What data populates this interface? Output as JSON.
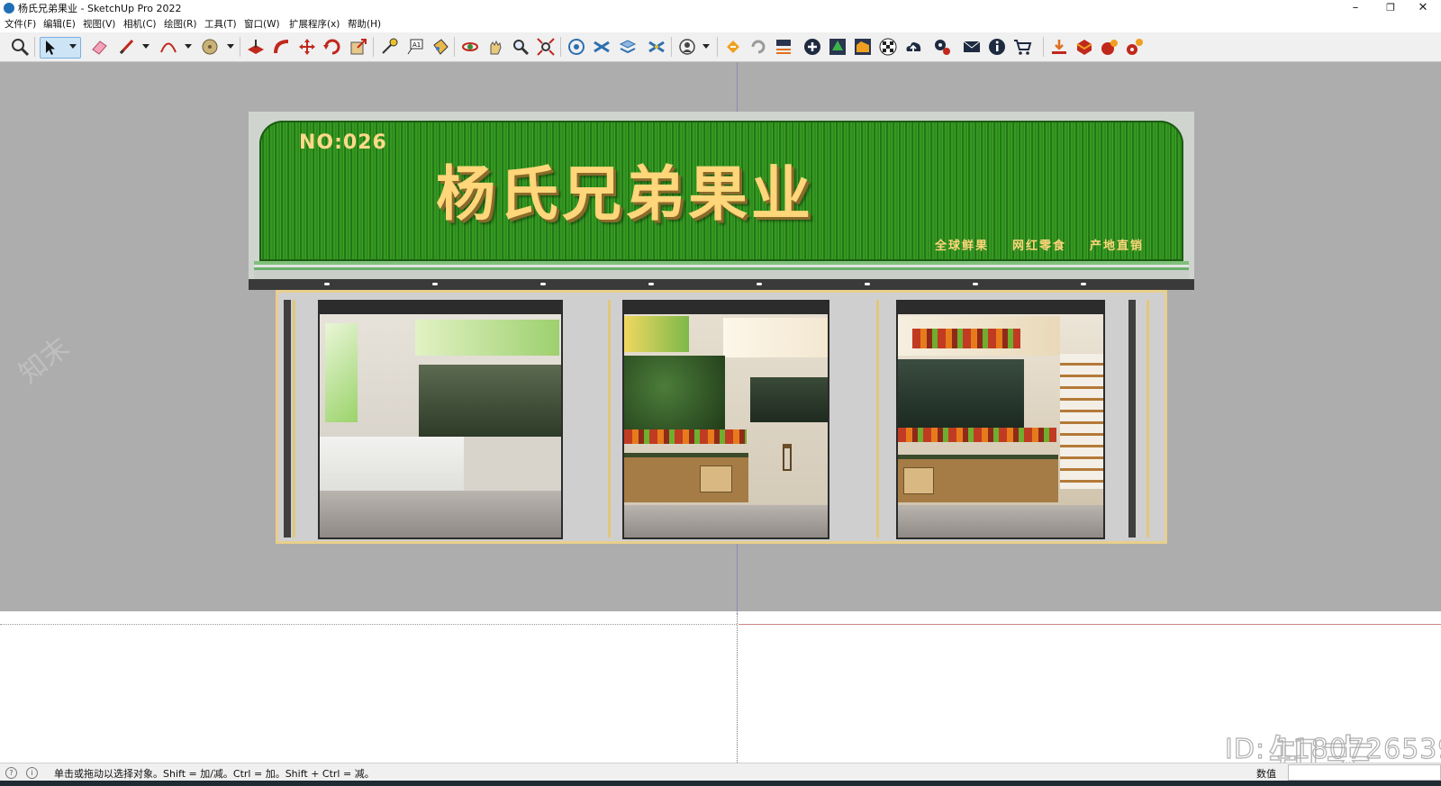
{
  "window": {
    "title": "杨氏兄弟果业 - SketchUp Pro 2022",
    "minimize": "–",
    "restore": "❐",
    "close": "✕"
  },
  "menu": [
    "文件(F)",
    "编辑(E)",
    "视图(V)",
    "相机(C)",
    "绘图(R)",
    "工具(T)",
    "窗口(W)",
    "扩展程序(x)",
    "帮助(H)"
  ],
  "toolbar": {
    "tools": [
      "zoom-window",
      "select",
      "eraser",
      "pencil-line",
      "arc",
      "paint-bucket",
      "push-pull",
      "follow-me",
      "move",
      "rotate",
      "scale",
      "tape-measure",
      "text",
      "paint",
      "orbit",
      "pan",
      "zoom",
      "zoom-extents",
      "warehouse-1",
      "warehouse-2",
      "warehouse-3",
      "warehouse-4",
      "user",
      "plugin-1",
      "plugin-2",
      "plugin-3",
      "add",
      "tree",
      "chart",
      "checker",
      "cloud",
      "settings",
      "mail",
      "info",
      "cart",
      "tool-1",
      "tool-2",
      "tool-3",
      "tool-4"
    ]
  },
  "sign": {
    "number": "NO:026",
    "title": "杨氏兄弟果业",
    "tags": [
      "全球鲜果",
      "网红零食",
      "产地直销"
    ]
  },
  "watermark": {
    "brand": "知末",
    "id": "ID: 1180726539"
  },
  "status": {
    "hint": "单击或拖动以选择对象。Shift = 加/减。Ctrl = 加。Shift + Ctrl = 减。",
    "measure_label": "数值",
    "measure_value": ""
  },
  "colors": {
    "sign_green": "#2e8c1e",
    "sign_text": "#ffd67a",
    "background_gray": "#adadad"
  }
}
